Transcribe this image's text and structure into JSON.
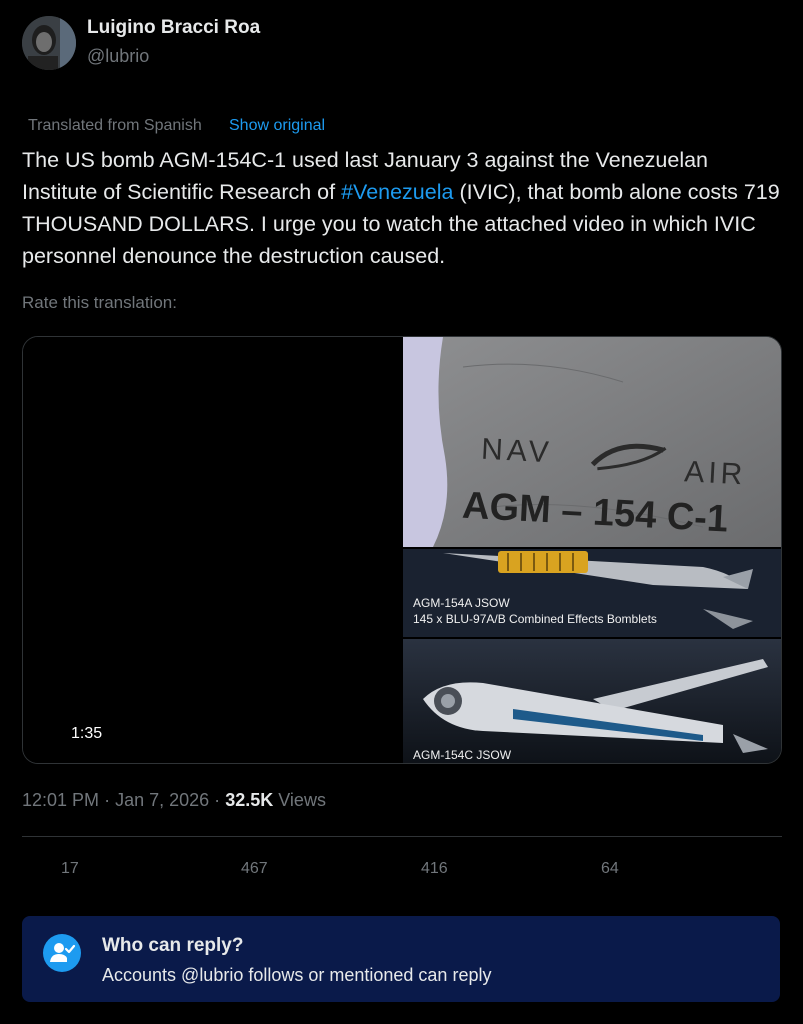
{
  "author": {
    "name": "Luigino Bracci Roa",
    "handle": "@lubrio"
  },
  "translation": {
    "note": "Translated from Spanish",
    "show_original": "Show original",
    "rate_label": "Rate this translation:"
  },
  "tweet": {
    "text_before": "The US bomb AGM-154C-1 used last January 3 against the Venezuelan Institute of Scientific Research of ",
    "hashtag": "#Venezuela",
    "text_after": " (IVIC), that bomb alone costs 719 THOUSAND DOLLARS. I urge you to watch the attached video in which IVIC personnel denounce the destruction caused."
  },
  "media": {
    "video_duration": "1:35",
    "panel_a": {
      "mark_left": "NAV",
      "mark_right": "AIR",
      "stencil": "AGM – 154 C-1"
    },
    "panel_b": {
      "line1": "AGM-154A JSOW",
      "line2": "145 x BLU-97A/B Combined Effects Bomblets"
    },
    "panel_c": {
      "line1": "AGM-154C JSOW"
    }
  },
  "meta": {
    "time": "12:01 PM",
    "sep1": "·",
    "date": "Jan 7, 2026",
    "sep2": "·",
    "views_count": "32.5K",
    "views_label": "Views"
  },
  "actions": {
    "replies": "17",
    "reposts": "467",
    "likes": "416",
    "bookmarks": "64"
  },
  "reply_settings": {
    "title": "Who can reply?",
    "description": "Accounts @lubrio follows or mentioned can reply"
  },
  "colors": {
    "background": "#000000",
    "text": "#e7e9ea",
    "muted": "#71767b",
    "link": "#1d9bf0",
    "reply_box": "#0a1a4a"
  },
  "icons": {
    "reply_settings": "person-check-icon"
  }
}
